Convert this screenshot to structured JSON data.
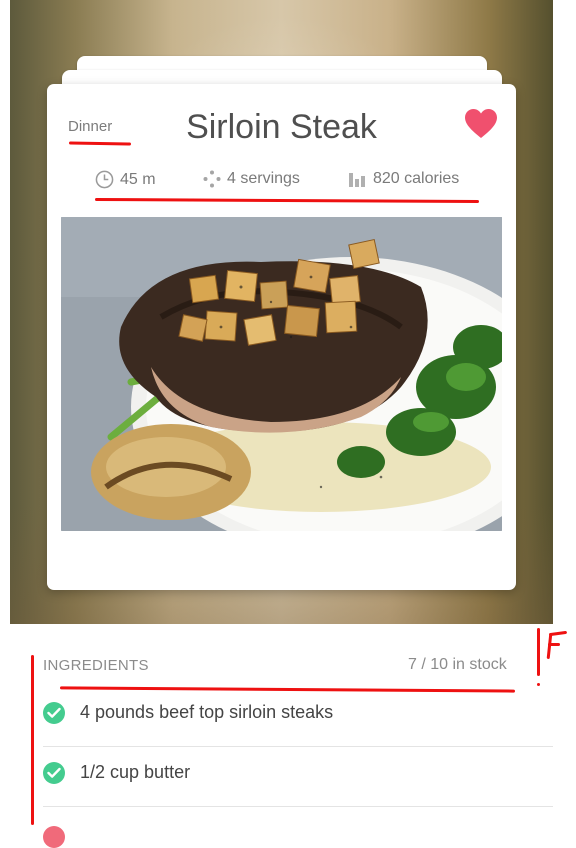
{
  "recipe": {
    "category": "Dinner",
    "title": "Sirloin Steak",
    "favorite": true,
    "meta": {
      "time": "45 m",
      "servings": "4 servings",
      "calories": "820 calories"
    },
    "image_alt": "Sirloin steak topped with diced potatoes, broccolini and roasted potato on a white plate"
  },
  "ingredients": {
    "title": "INGREDIENTS",
    "stock": "7 / 10 in stock",
    "items": [
      {
        "label": "4 pounds beef top sirloin steaks",
        "in_stock": true
      },
      {
        "label": "1/2 cup butter",
        "in_stock": true
      }
    ]
  },
  "icons": {
    "favorite": "heart-icon",
    "time": "clock-icon",
    "servings": "servings-icon",
    "calories": "bar-chart-icon",
    "stock_check": "check-circle-icon"
  },
  "colors": {
    "heart": "#f0506e",
    "check": "#44cc8f",
    "annotation": "#ee1111"
  }
}
